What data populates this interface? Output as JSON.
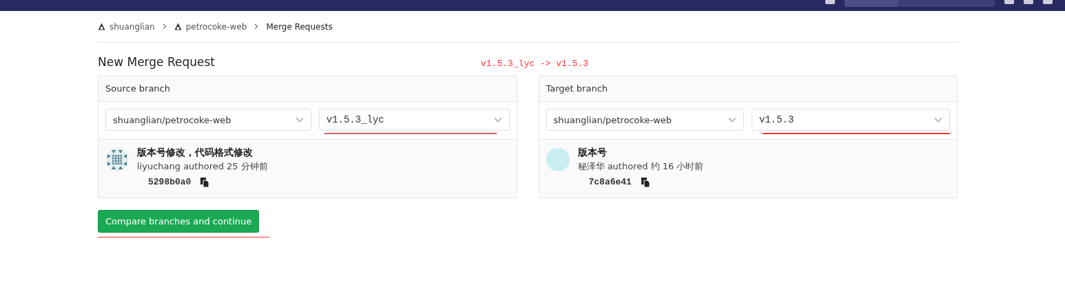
{
  "breadcrumbs": [
    {
      "label": "shuanglian",
      "kind": "group"
    },
    {
      "label": "petrocoke-web",
      "kind": "project"
    },
    {
      "label": "Merge Requests",
      "kind": "page"
    }
  ],
  "title": "New Merge Request",
  "annotation": "v1.5.3_lyc -> v1.5.3",
  "panels": [
    {
      "heading": "Source branch",
      "project": "shuanglian/petrocoke-web",
      "branch": "v1.5.3_lyc",
      "commit": {
        "message": "版本号修改，代码格式修改",
        "author": "liyuchang authored 25 分钟前",
        "sha": "5298b0a0",
        "avatar": {
          "kind": "pattern"
        }
      }
    },
    {
      "heading": "Target branch",
      "project": "shuanglian/petrocoke-web",
      "branch": "v1.5.3",
      "commit": {
        "message": "版本号",
        "author": "秘泽华 authored 约 16 小时前",
        "sha": "7c8a6e41",
        "avatar": {
          "kind": "plain"
        }
      }
    }
  ],
  "button": "Compare branches and continue"
}
